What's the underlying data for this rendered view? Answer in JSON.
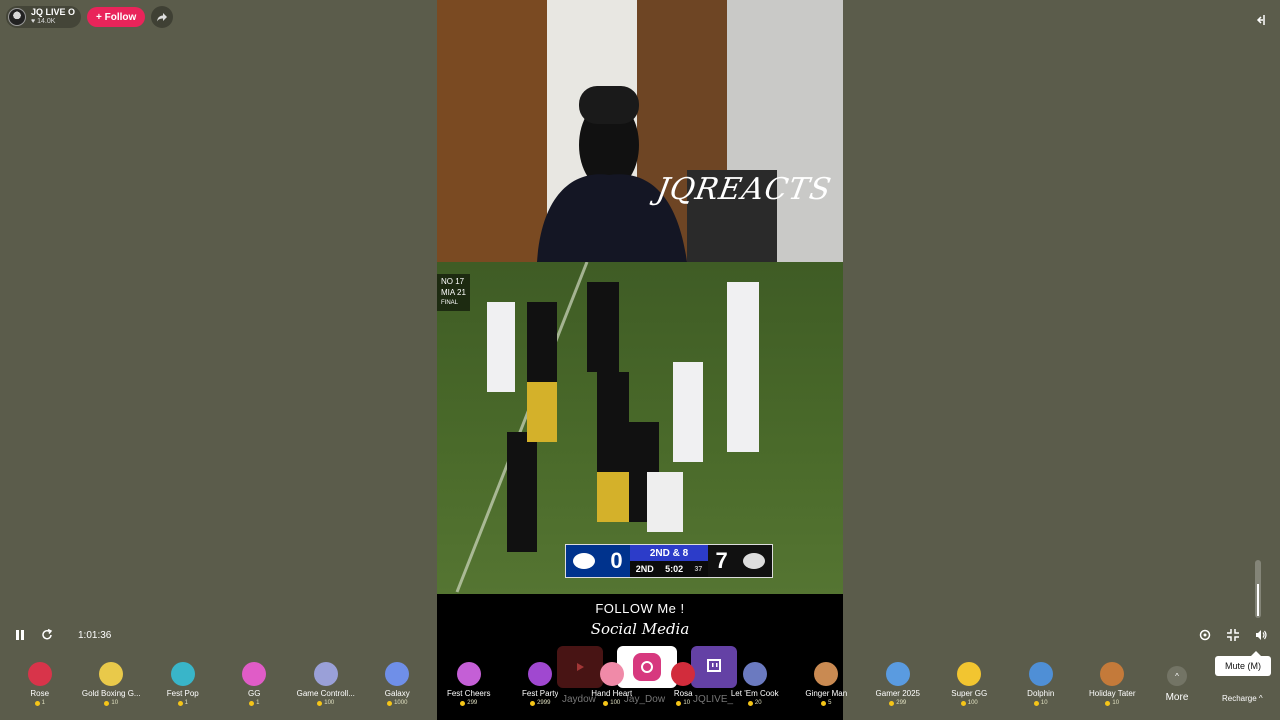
{
  "host": {
    "name": "JQ LIVE O",
    "likes": "14.0K",
    "follow_label": "+ Follow"
  },
  "video": {
    "watermark": "JQREACTS",
    "mini_score": [
      "NO  17",
      "MIA  21",
      "FINAL"
    ],
    "scorebug": {
      "away_score": "0",
      "home_score": "7",
      "down": "2ND & 8",
      "quarter": "2ND",
      "clock": "5:02",
      "play_clock": "37"
    },
    "promo_title": "FOLLOW Me !",
    "promo_subtitle": "Social Media",
    "social_names": [
      "Jaydow",
      "Jay_Dow",
      "JQLIVE_"
    ]
  },
  "player": {
    "time": "1:01:36",
    "tooltip": "Mute (M)"
  },
  "gifts": [
    {
      "name": "Rose",
      "price": "1",
      "color": "#d8344a"
    },
    {
      "name": "Gold Boxing G...",
      "price": "10",
      "color": "#e9c94a"
    },
    {
      "name": "Fest Pop",
      "price": "1",
      "color": "#39b5c9"
    },
    {
      "name": "GG",
      "price": "1",
      "color": "#e05cc7"
    },
    {
      "name": "Game Controll...",
      "price": "100",
      "color": "#9aa0d8"
    },
    {
      "name": "Galaxy",
      "price": "1000",
      "color": "#6f8fe8"
    },
    {
      "name": "Fest Cheers",
      "price": "299",
      "color": "#c45fd6"
    },
    {
      "name": "Fest Party",
      "price": "2999",
      "color": "#a048d0"
    },
    {
      "name": "Hand Heart",
      "price": "100",
      "color": "#f08aa8"
    },
    {
      "name": "Rosa",
      "price": "10",
      "color": "#d22c3c"
    },
    {
      "name": "Let 'Em Cook",
      "price": "20",
      "color": "#6b7ac0"
    },
    {
      "name": "Ginger Man",
      "price": "5",
      "color": "#c98a52"
    },
    {
      "name": "Gamer 2025",
      "price": "299",
      "color": "#5a9be0"
    },
    {
      "name": "Super GG",
      "price": "100",
      "color": "#f2c530"
    },
    {
      "name": "Dolphin",
      "price": "10",
      "color": "#4f8fd6"
    },
    {
      "name": "Holiday Tater",
      "price": "10",
      "color": "#c47a3a"
    }
  ],
  "more_label": "More",
  "recharge_label": "Recharge"
}
